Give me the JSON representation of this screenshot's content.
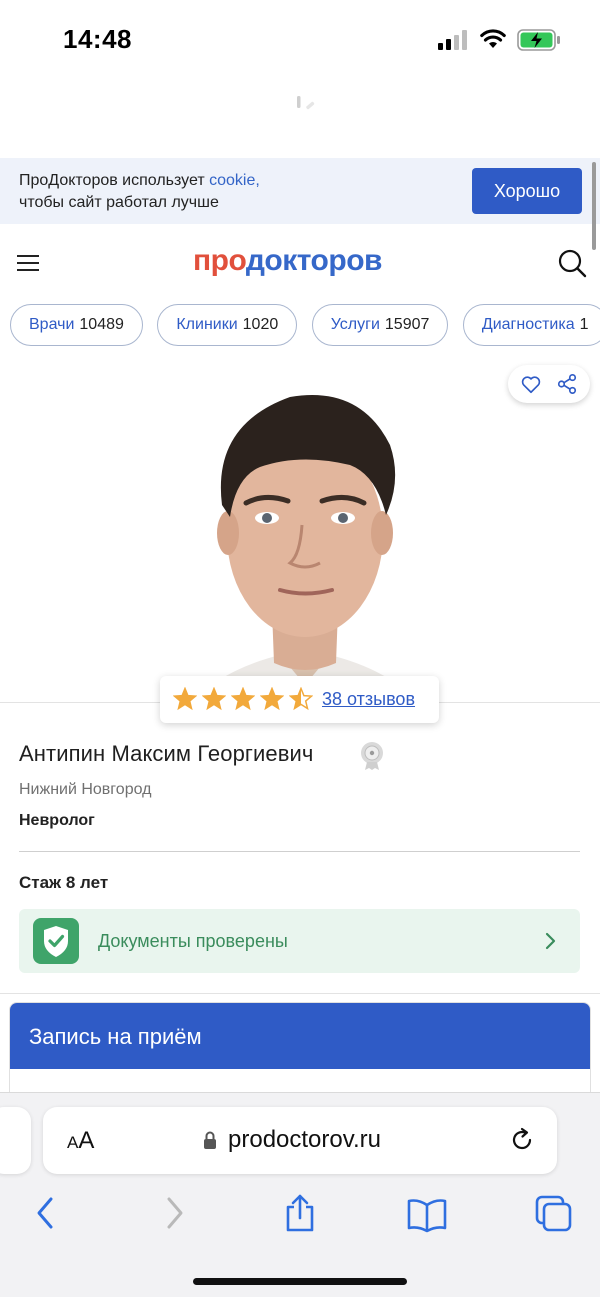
{
  "status_bar": {
    "time": "14:48"
  },
  "cookie_banner": {
    "text_before_link": "ПроДокторов использует ",
    "link": "cookie,",
    "text_after_link": "чтобы сайт работал лучше",
    "button": "Хорошо"
  },
  "header": {
    "logo_part1": "про",
    "logo_part2": "докторов"
  },
  "chips": [
    {
      "label": "Врачи",
      "count": "10489"
    },
    {
      "label": "Клиники",
      "count": "1020"
    },
    {
      "label": "Услуги",
      "count": "15907"
    },
    {
      "label": "Диагностика",
      "count": "1"
    }
  ],
  "doctor": {
    "rating": 4.5,
    "reviews": "38 отзывов",
    "name": "Антипин Максим Георгиевич",
    "city": "Нижний Новгород",
    "specialty": "Невролог",
    "experience": "Стаж 8 лет",
    "documents": "Документы проверены"
  },
  "appointment": {
    "title": "Запись на приём"
  },
  "browser": {
    "text_size_small": "A",
    "text_size_large": "A",
    "url": "prodoctorov.ru"
  },
  "colors": {
    "brand_blue": "#2f5bc6",
    "logo_red": "#e1503c",
    "star": "#f2a93b",
    "verified_green": "#3fa46a"
  }
}
